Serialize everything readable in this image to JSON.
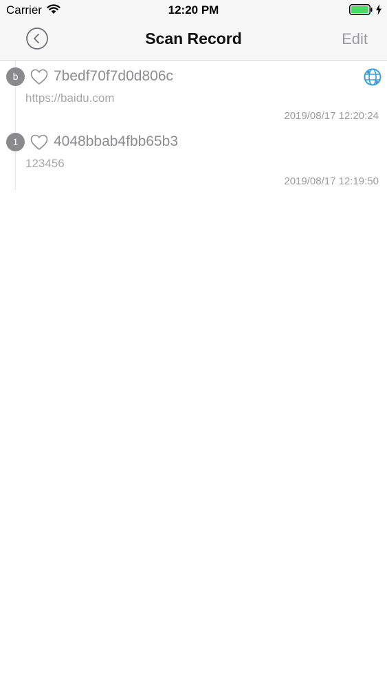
{
  "status_bar": {
    "carrier": "Carrier",
    "time": "12:20 PM",
    "wifi_icon": "wifi-icon",
    "battery_icon": "battery-full-icon",
    "battery_color": "#4cd964"
  },
  "nav_bar": {
    "back_icon": "chevron-left-circle-icon",
    "title": "Scan Record",
    "edit_label": "Edit"
  },
  "records": [
    {
      "badge": "b",
      "favorite_icon": "heart-outline-icon",
      "title": "7bedf70f7d0d806c",
      "content": "https://baidu.com",
      "timestamp": "2019/08/17 12:20:24",
      "action_icon": "globe-icon",
      "action_color": "#3a9fd6"
    },
    {
      "badge": "1",
      "favorite_icon": "heart-outline-icon",
      "title": "4048bbab4fbb65b3",
      "content": "123456",
      "timestamp": "2019/08/17 12:19:50"
    }
  ]
}
